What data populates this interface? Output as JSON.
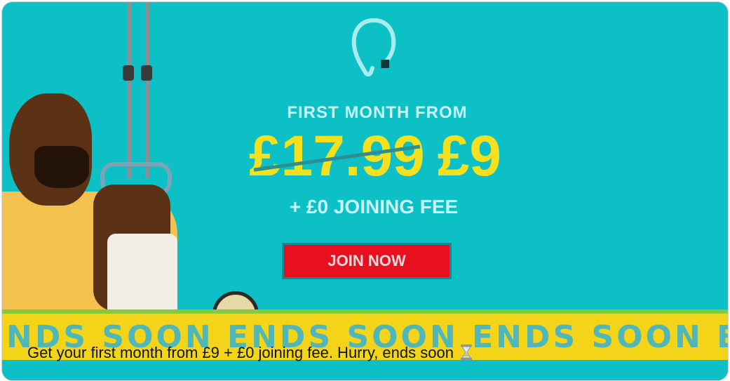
{
  "banner": {
    "eyebrow": "FIRST MONTH FROM",
    "price_old": "£17.99",
    "price_new": "£9",
    "fee": "+ £0 JOINING FEE",
    "cta_label": "JOIN NOW",
    "ticker": "ENDS SOON ENDS SOON ENDS SOON ENDS SOO",
    "logo_icon": "pure-gym-logo-icon",
    "colors": {
      "background": "#0cc0c6",
      "price": "#f4e01e",
      "cta": "#e8101e",
      "ticker": "#f3d419"
    }
  },
  "caption": {
    "text": "Get your first month from £9 + £0 joining fee. Hurry, ends soon",
    "emoji_icon": "hourglass-icon"
  }
}
